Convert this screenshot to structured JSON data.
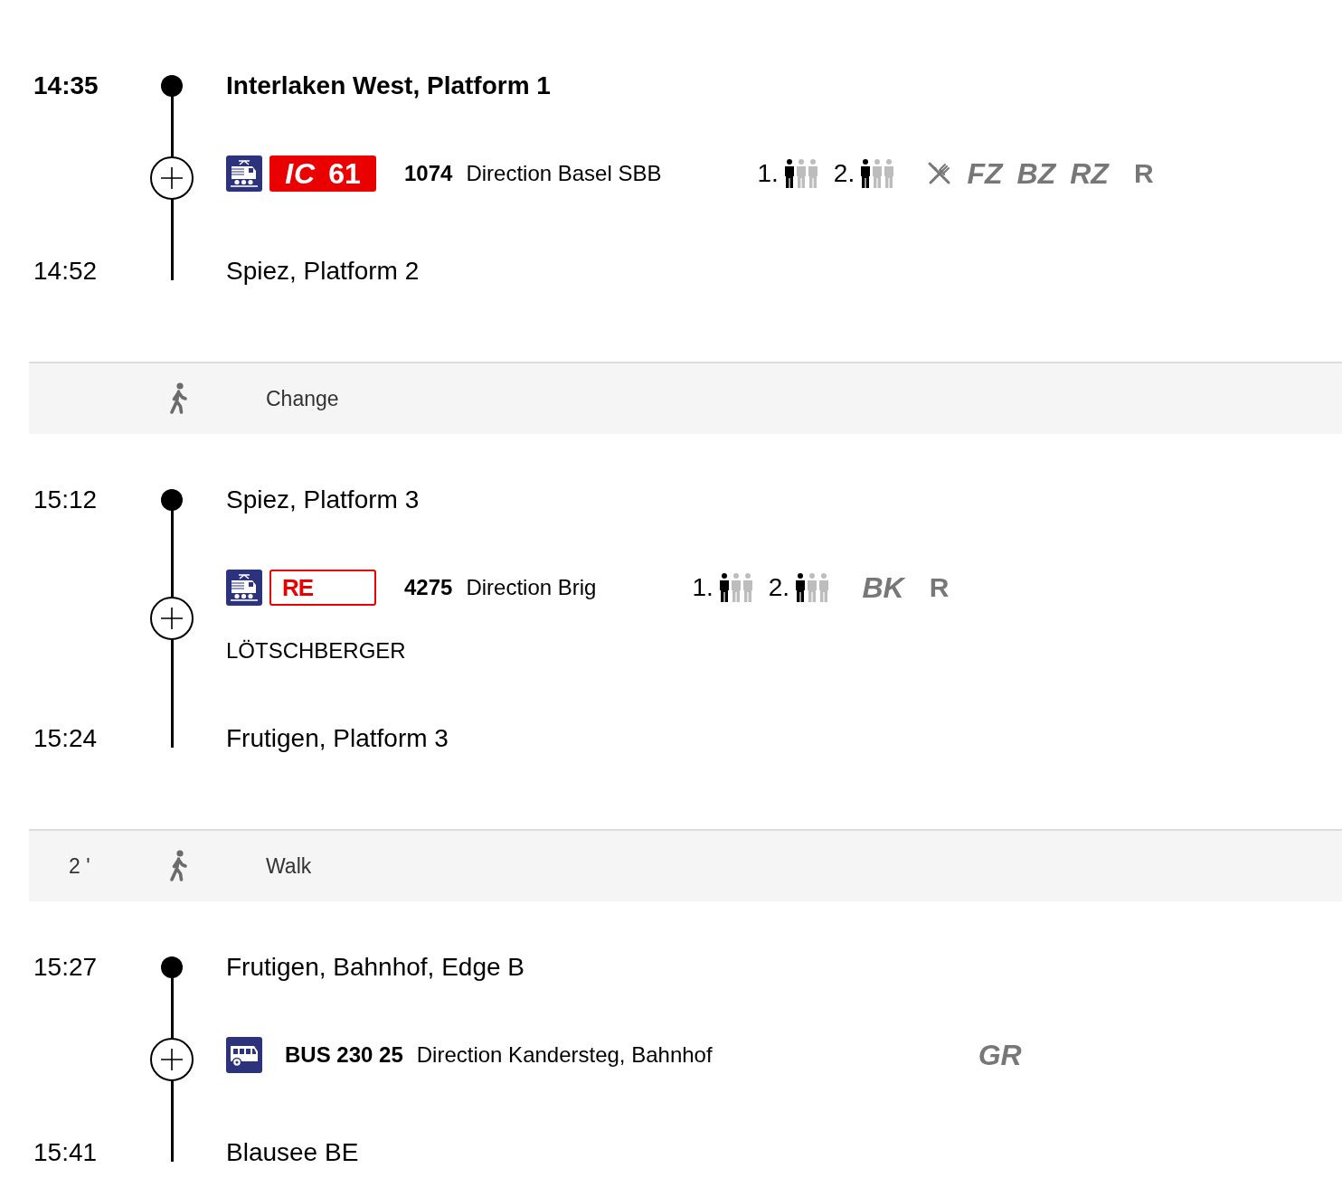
{
  "journey": [
    {
      "kind": "leg",
      "expanded": false,
      "departure": {
        "time": "14:35",
        "stop": "Interlaken West, Platform 1",
        "emphasized": true
      },
      "service": {
        "kind": "train",
        "badge": {
          "kind": "filled",
          "label": "IC",
          "line": "61"
        },
        "number": "1074",
        "direction": "Direction Basel SBB",
        "occupancy": [
          {
            "class": "1.",
            "persons": [
              {
                "filled": true
              },
              {
                "filled": false
              },
              {
                "filled": false
              }
            ]
          },
          {
            "class": "2.",
            "persons": [
              {
                "filled": true
              },
              {
                "filled": false
              },
              {
                "filled": false
              }
            ]
          }
        ],
        "catering": true,
        "attributes": [
          {
            "kind": "italic",
            "text": "FZ"
          },
          {
            "kind": "italic",
            "text": "BZ"
          },
          {
            "kind": "italic",
            "text": "RZ"
          },
          {
            "kind": "upright",
            "text": "R"
          }
        ]
      },
      "arrival": {
        "time": "14:52",
        "stop": "Spiez, Platform 2",
        "emphasized": false
      }
    },
    {
      "kind": "transfer",
      "label": "Change"
    },
    {
      "kind": "leg",
      "expanded": false,
      "departure": {
        "time": "15:12",
        "stop": "Spiez, Platform 3",
        "emphasized": false
      },
      "service": {
        "kind": "train",
        "badge": {
          "kind": "outline",
          "label": "RE"
        },
        "number": "4275",
        "direction": "Direction Brig",
        "occupancy": [
          {
            "class": "1.",
            "persons": [
              {
                "filled": true
              },
              {
                "filled": false
              },
              {
                "filled": false
              }
            ]
          },
          {
            "class": "2.",
            "persons": [
              {
                "filled": true
              },
              {
                "filled": false
              },
              {
                "filled": false
              }
            ]
          }
        ],
        "catering": false,
        "attributes": [
          {
            "kind": "italic",
            "text": "BK"
          },
          {
            "kind": "upright",
            "text": "R"
          }
        ],
        "name": "LÖTSCHBERGER"
      },
      "arrival": {
        "time": "15:24",
        "stop": "Frutigen, Platform 3",
        "emphasized": false
      }
    },
    {
      "kind": "transfer",
      "duration": "2 '",
      "label": "Walk"
    },
    {
      "kind": "leg",
      "expanded": false,
      "departure": {
        "time": "15:27",
        "stop": "Frutigen, Bahnhof, Edge B",
        "emphasized": false
      },
      "service": {
        "kind": "bus",
        "number": "BUS 230 25",
        "direction": "Direction Kandersteg, Bahnhof",
        "catering": false,
        "attributes": [
          {
            "kind": "italic",
            "text": "GR"
          }
        ]
      },
      "arrival": {
        "time": "15:41",
        "stop": "Blausee BE",
        "emphasized": false
      }
    }
  ]
}
